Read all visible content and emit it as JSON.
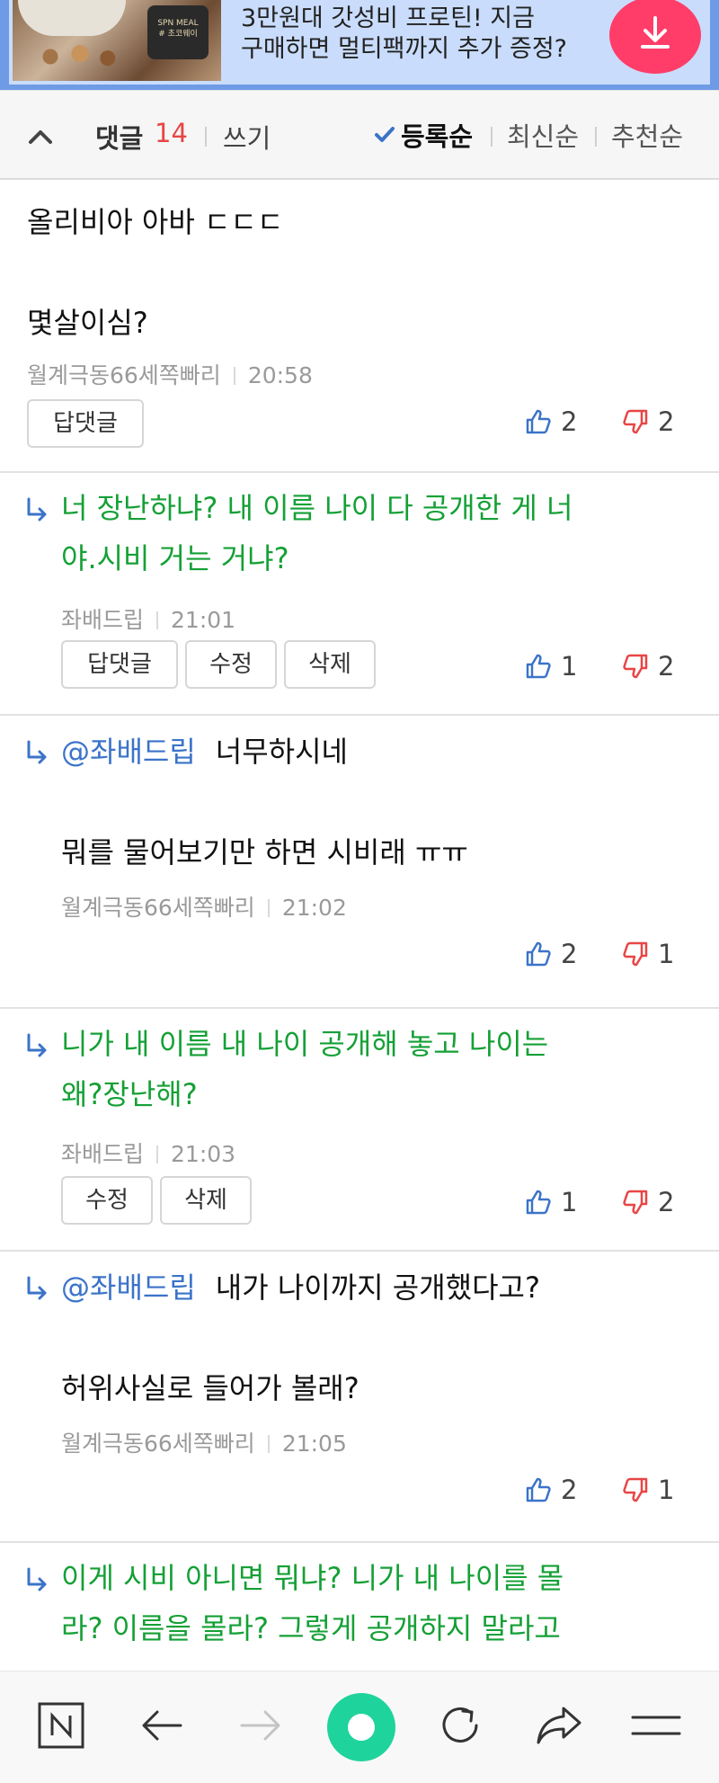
{
  "ad": {
    "line1": "3만원대 갓성비 프로틴! 지금",
    "line2": "구매하면 멀티팩까지 추가 증정?",
    "badge": "SPN MEAL\n# 초코웨이"
  },
  "comment_bar": {
    "title": "댓글",
    "count": "14",
    "write": "쓰기",
    "sort": [
      "등록순",
      "최신순",
      "추천순"
    ]
  },
  "comments": [
    {
      "line1": "올리비아 아바 ㄷㄷㄷ",
      "line2": "몇살이심?",
      "author": "월계극동66세쪽빠리",
      "time": "20:58",
      "buttons": [
        "답댓글"
      ],
      "likes": "2",
      "dislikes": "2"
    },
    {
      "line1": "너 장난하냐? 내 이름 나이 다 공개한 게 너",
      "line2": "야.시비 거는 거냐?",
      "author": "좌배드립",
      "time": "21:01",
      "buttons": [
        "답댓글",
        "수정",
        "삭제"
      ],
      "likes": "1",
      "dislikes": "2"
    },
    {
      "mention": "@좌배드립",
      "line1": "너무하시네",
      "line2": "뭐를 물어보기만 하면 시비래 ㅠㅠ",
      "author": "월계극동66세쪽빠리",
      "time": "21:02",
      "likes": "2",
      "dislikes": "1"
    },
    {
      "line1": "니가 내 이름 내 나이 공개해 놓고 나이는",
      "line2": "왜?장난해?",
      "author": "좌배드립",
      "time": "21:03",
      "buttons": [
        "수정",
        "삭제"
      ],
      "likes": "1",
      "dislikes": "2"
    },
    {
      "mention": "@좌배드립",
      "line1": "내가 나이까지 공개했다고?",
      "line2": "허위사실로 들어가 볼래?",
      "author": "월계극동66세쪽빠리",
      "time": "21:05",
      "likes": "2",
      "dislikes": "1"
    },
    {
      "line1": "이게 시비 아니면 뭐냐? 니가 내 나이를 몰",
      "line2": "라? 이름을 몰라? 그렇게 공개하지 말라고"
    }
  ],
  "colors": {
    "accent_green": "#15a036",
    "mention_blue": "#3b73c9",
    "count_red": "#e84545",
    "home_green": "#1fd39c"
  },
  "icons": [
    "download-icon",
    "collapse-icon",
    "check-icon",
    "reply-arrow-icon",
    "thumbs-up-icon",
    "thumbs-down-icon",
    "naver-n-icon",
    "back-icon",
    "forward-icon",
    "home-icon",
    "refresh-icon",
    "share-icon",
    "menu-icon"
  ]
}
